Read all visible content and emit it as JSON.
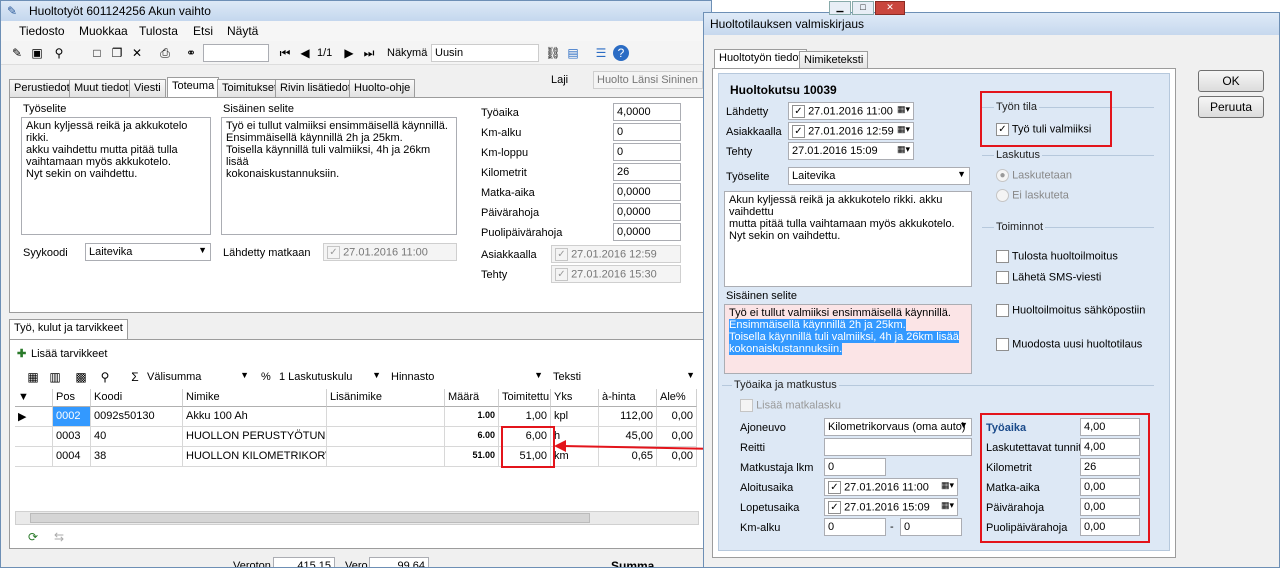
{
  "main_window": {
    "title": "Huoltotyöt 601124256 Akun vaihto",
    "menu": [
      "Tiedosto",
      "Muokkaa",
      "Tulosta",
      "Etsi",
      "Näytä"
    ],
    "toolbar": {
      "record_position": "1/1",
      "view_label": "Näkymä",
      "view_value": "Uusin"
    },
    "tabs": [
      "Perustiedot",
      "Muut tiedot",
      "Viesti",
      "Toteuma",
      "Toimitukset",
      "Rivin lisätiedot",
      "Huolto-ohje"
    ],
    "laji_label": "Laji",
    "laji_value": "Huolto Länsi Sininen",
    "tyoselite_label": "Työselite",
    "tyoselite_text": "Akun kyljessä reikä ja akkukotelo rikki.\nakku vaihdettu mutta pitää tulla\nvaihtamaan myös akkukotelo.\nNyt sekin on vaihdettu.",
    "sisainen_label": "Sisäinen selite",
    "sisainen_text": "Työ ei tullut valmiiksi ensimmäisellä käynnillä.\nEnsimmäisellä käynnillä 2h ja 25km.\nToisella käynnillä tuli valmiiksi, 4h ja 26km lisää\nkokonaiskustannuksiin.",
    "syykoodi_label": "Syykoodi",
    "syykoodi_value": "Laitevika",
    "lahdetty_matkaan_label": "Lähdetty matkaan",
    "lahdetty_matkaan_value": "27.01.2016 11:00",
    "fields": [
      {
        "label": "Työaika",
        "value": "4,0000"
      },
      {
        "label": "Km-alku",
        "value": "0"
      },
      {
        "label": "Km-loppu",
        "value": "0"
      },
      {
        "label": "Kilometrit",
        "value": "26"
      },
      {
        "label": "Matka-aika",
        "value": "0,0000"
      },
      {
        "label": "Päivärahoja",
        "value": "0,0000"
      },
      {
        "label": "Puolipäivärahoja",
        "value": "0,0000"
      }
    ],
    "asiakkaalla_label": "Asiakkaalla",
    "asiakkaalla_value": "27.01.2016 12:59",
    "tehty_label": "Tehty",
    "tehty_value": "27.01.2016 15:30",
    "bottom_tab": "Työ, kulut ja tarvikkeet",
    "add_items_label": "Lisää tarvikkeet",
    "grid_toolbar": {
      "valisumma": "Välisumma",
      "percent": "%",
      "laskutuskulu": "1 Laskutuskulu",
      "hinnasto": "Hinnasto",
      "teksti": "Teksti"
    },
    "columns": [
      "Pos",
      "Koodi",
      "Nimike",
      "Lisänimike",
      "Määrä",
      "Toimitettu",
      "Yks",
      "à-hinta",
      "Ale%"
    ],
    "rows": [
      [
        "0002",
        "0092s50130",
        "Akku 100 Ah",
        "",
        "1.00",
        "1,00",
        "kpl",
        "112,00",
        "0,00"
      ],
      [
        "0003",
        "40",
        "HUOLLON PERUSTYÖTUNNIT",
        "",
        "6.00",
        "6,00",
        "h",
        "45,00",
        "0,00"
      ],
      [
        "0004",
        "38",
        "HUOLLON KILOMETRIKORVAUS",
        "",
        "51.00",
        "51,00",
        "km",
        "0,65",
        "0,00"
      ]
    ],
    "footer": {
      "verottom_label": "Veroton",
      "verottom_value": "415,15",
      "vero_label": "Vero",
      "vero_value": "99,64",
      "summa_label": "Summa"
    }
  },
  "dialog": {
    "title": "Huoltotilauksen valmiskirjaus",
    "tabs": [
      "Huoltotyön tiedot",
      "Nimiketeksti"
    ],
    "ok_label": "OK",
    "cancel_label": "Peruuta",
    "header": "Huoltokutsu 10039",
    "lahdetty_label": "Lähdetty",
    "lahdetty_value": "27.01.2016 11:00",
    "asiakkaalla_label": "Asiakkaalla",
    "asiakkaalla_value": "27.01.2016 12:59",
    "tehty_label": "Tehty",
    "tehty_value": "27.01.2016 15:09",
    "tyoselite_label": "Työselite",
    "tyoselite_value": "Laitevika",
    "tyoselite_text": "Akun kyljessä reikä ja akkukotelo rikki. akku vaihdettu\nmutta pitää tulla vaihtamaan myös akkukotelo.\nNyt sekin on vaihdettu.",
    "sisainen_label": "Sisäinen selite",
    "sisainen_line1": "Työ ei tullut valmiiksi ensimmäisellä käynnillä.",
    "sisainen_line2": "Ensimmäisellä käynnillä 2h ja 25km.",
    "sisainen_line3": "Toisella käynnillä tuli valmiiksi, 4h ja 26km lisää",
    "sisainen_line4": "kokonaiskustannuksiin.",
    "tyon_tila_label": "Työn tila",
    "tyo_tuli_valmiiksi": "Työ tuli valmiiksi",
    "laskutus_label": "Laskutus",
    "laskutetaan": "Laskutetaan",
    "ei_laskuteta": "Ei laskuteta",
    "toiminnot_label": "Toiminnot",
    "toiminnot": [
      "Tulosta huoltoilmoitus",
      "Lähetä SMS-viesti",
      "Huoltoilmoitus sähköpostiin",
      "Muodosta uusi huoltotilaus"
    ],
    "matkustus_label": "Työaika ja matkustus",
    "lisaa_matkalasku": "Lisää matkalasku",
    "ajoneuvo_label": "Ajoneuvo",
    "ajoneuvo_value": "Kilometrikorvaus (oma auto)",
    "reitti_label": "Reitti",
    "matkustajia_label": "Matkustaja lkm",
    "matkustajia_value": "0",
    "aloitusaika_label": "Aloitusaika",
    "aloitusaika_value": "27.01.2016 11:00",
    "lopetusaika_label": "Lopetusaika",
    "lopetusaika_value": "27.01.2016 15:09",
    "kmalku_label": "Km-alku",
    "kmalku_value": "0",
    "kmloppu_value": "0",
    "right_fields": [
      {
        "label": "Työaika",
        "value": "4,00"
      },
      {
        "label": "Laskutettavat tunnit",
        "value": "4,00"
      },
      {
        "label": "Kilometrit",
        "value": "26"
      },
      {
        "label": "Matka-aika",
        "value": "0,00"
      },
      {
        "label": "Päivärahoja",
        "value": "0,00"
      },
      {
        "label": "Puolipäivärahoja",
        "value": "0,00"
      }
    ]
  },
  "colors": {
    "annotation_red": "#e3141b",
    "selection_blue": "#3399ff",
    "panel_blue": "#dde8f5"
  }
}
